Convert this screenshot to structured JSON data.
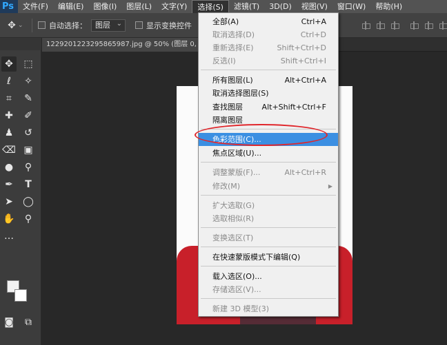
{
  "menubar": {
    "logo": "Ps",
    "items": [
      "文件(F)",
      "编辑(E)",
      "图像(I)",
      "图层(L)",
      "文字(Y)",
      "选择(S)",
      "滤镜(T)",
      "3D(D)",
      "视图(V)",
      "窗口(W)",
      "帮助(H)"
    ],
    "active": "选择(S)"
  },
  "options": {
    "move_icon": "✥",
    "auto_select_label": "自动选择：",
    "auto_select_value": "图层",
    "show_transform_label": "显示变换控件"
  },
  "document": {
    "tab_title": "1229201223295865987.jpg @ 50% (图层 0,"
  },
  "select_menu": {
    "items": [
      {
        "label": "全部(A)",
        "shortcut": "Ctrl+A",
        "disabled": false
      },
      {
        "label": "取消选择(D)",
        "shortcut": "Ctrl+D",
        "disabled": true
      },
      {
        "label": "重新选择(E)",
        "shortcut": "Shift+Ctrl+D",
        "disabled": true
      },
      {
        "label": "反选(I)",
        "shortcut": "Shift+Ctrl+I",
        "disabled": true
      },
      {
        "label": "所有图层(L)",
        "shortcut": "Alt+Ctrl+A",
        "disabled": false
      },
      {
        "label": "取消选择图层(S)",
        "shortcut": "",
        "disabled": false
      },
      {
        "label": "查找图层",
        "shortcut": "Alt+Shift+Ctrl+F",
        "disabled": false
      },
      {
        "label": "隔离图层",
        "shortcut": "",
        "disabled": false
      },
      {
        "label": "色彩范围(C)...",
        "shortcut": "",
        "disabled": false,
        "highlighted": true
      },
      {
        "label": "焦点区域(U)...",
        "shortcut": "",
        "disabled": false
      },
      {
        "label": "调整蒙版(F)...",
        "shortcut": "Alt+Ctrl+R",
        "disabled": true
      },
      {
        "label": "修改(M)",
        "shortcut": "",
        "disabled": true,
        "submenu": true
      },
      {
        "label": "扩大选取(G)",
        "shortcut": "",
        "disabled": true
      },
      {
        "label": "选取相似(R)",
        "shortcut": "",
        "disabled": true
      },
      {
        "label": "变换选区(T)",
        "shortcut": "",
        "disabled": true
      },
      {
        "label": "在快速蒙版模式下编辑(Q)",
        "shortcut": "",
        "disabled": false
      },
      {
        "label": "载入选区(O)...",
        "shortcut": "",
        "disabled": false
      },
      {
        "label": "存储选区(V)...",
        "shortcut": "",
        "disabled": true
      },
      {
        "label": "新建 3D 模型(3)",
        "shortcut": "",
        "disabled": true
      }
    ]
  },
  "colors": {
    "accent_highlight": "#3b8fe2",
    "annotation": "#e0262b",
    "shirt": "#c8202a"
  },
  "tools": [
    {
      "name": "move-tool-icon",
      "glyph": "✥"
    },
    {
      "name": "marquee-tool-icon",
      "glyph": "⬚"
    },
    {
      "name": "lasso-tool-icon",
      "glyph": "ℓ"
    },
    {
      "name": "magic-wand-tool-icon",
      "glyph": "✧"
    },
    {
      "name": "crop-tool-icon",
      "glyph": "⌗"
    },
    {
      "name": "eyedropper-tool-icon",
      "glyph": "✎"
    },
    {
      "name": "healing-brush-tool-icon",
      "glyph": "✚"
    },
    {
      "name": "brush-tool-icon",
      "glyph": "✐"
    },
    {
      "name": "stamp-tool-icon",
      "glyph": "♟"
    },
    {
      "name": "history-brush-tool-icon",
      "glyph": "↺"
    },
    {
      "name": "eraser-tool-icon",
      "glyph": "⌫"
    },
    {
      "name": "gradient-tool-icon",
      "glyph": "▣"
    },
    {
      "name": "blur-tool-icon",
      "glyph": "●"
    },
    {
      "name": "dodge-tool-icon",
      "glyph": "⚲"
    },
    {
      "name": "pen-tool-icon",
      "glyph": "✒"
    },
    {
      "name": "type-tool-icon",
      "glyph": "T"
    },
    {
      "name": "path-select-tool-icon",
      "glyph": "➤"
    },
    {
      "name": "ellipse-tool-icon",
      "glyph": "◯"
    },
    {
      "name": "hand-tool-icon",
      "glyph": "✋"
    },
    {
      "name": "zoom-tool-icon",
      "glyph": "⚲"
    },
    {
      "name": "more-tools-icon",
      "glyph": "…"
    },
    {
      "name": "quick-mask-icon",
      "glyph": "◙"
    },
    {
      "name": "screen-mode-icon",
      "glyph": "⧉"
    }
  ]
}
